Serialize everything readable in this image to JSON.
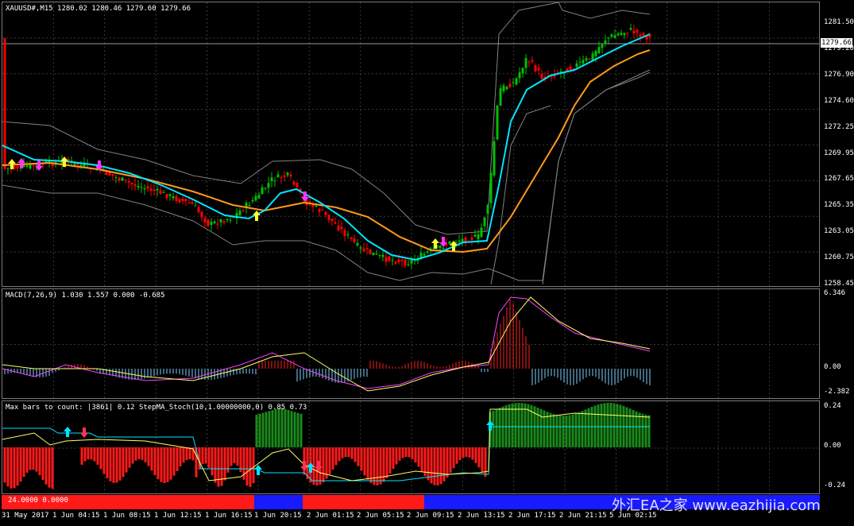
{
  "main": {
    "symbol_header": "XAUUSD#,M15  1280.02 1280.46 1279.60 1279.66",
    "price_tag": "1279.66",
    "yticks": [
      "1281.50",
      "1279.20",
      "1276.90",
      "1274.60",
      "1272.25",
      "1269.95",
      "1267.65",
      "1265.35",
      "1263.05",
      "1260.75",
      "1258.45"
    ]
  },
  "macd": {
    "header": "MACD(7,26,9) 1.030 1.557 0.000 -0.685",
    "yticks": [
      "6.346",
      "0.00",
      "-2.382"
    ]
  },
  "stoch": {
    "header": "Max bars to count: |3861|   0.12  StepMA_Stoch(10,1.00000000,0) 0.85 0.73",
    "yticks": [
      "0.24",
      "0.00",
      "-0.24"
    ]
  },
  "status": {
    "text": "24.0000 0.0000"
  },
  "xaxis": {
    "ticks": [
      "31 May 2017",
      "1 Jun 04:15",
      "1 Jun 08:15",
      "1 Jun 12:15",
      "1 Jun 16:15",
      "1 Jun 20:15",
      "2 Jun 01:15",
      "2 Jun 05:15",
      "2 Jun 09:15",
      "2 Jun 13:15",
      "2 Jun 17:15",
      "2 Jun 21:15",
      "5 Jun 02:15"
    ]
  },
  "watermark": "外汇EA之家 www.eazhijia.com",
  "colors": {
    "bull": "#00c000",
    "bear": "#ff0000",
    "fast_ma": "#00e5ff",
    "slow_ma": "#ff9a1a",
    "bands": "#808080",
    "signal": "#ffff66",
    "macd_line": "#ff40ff"
  }
}
